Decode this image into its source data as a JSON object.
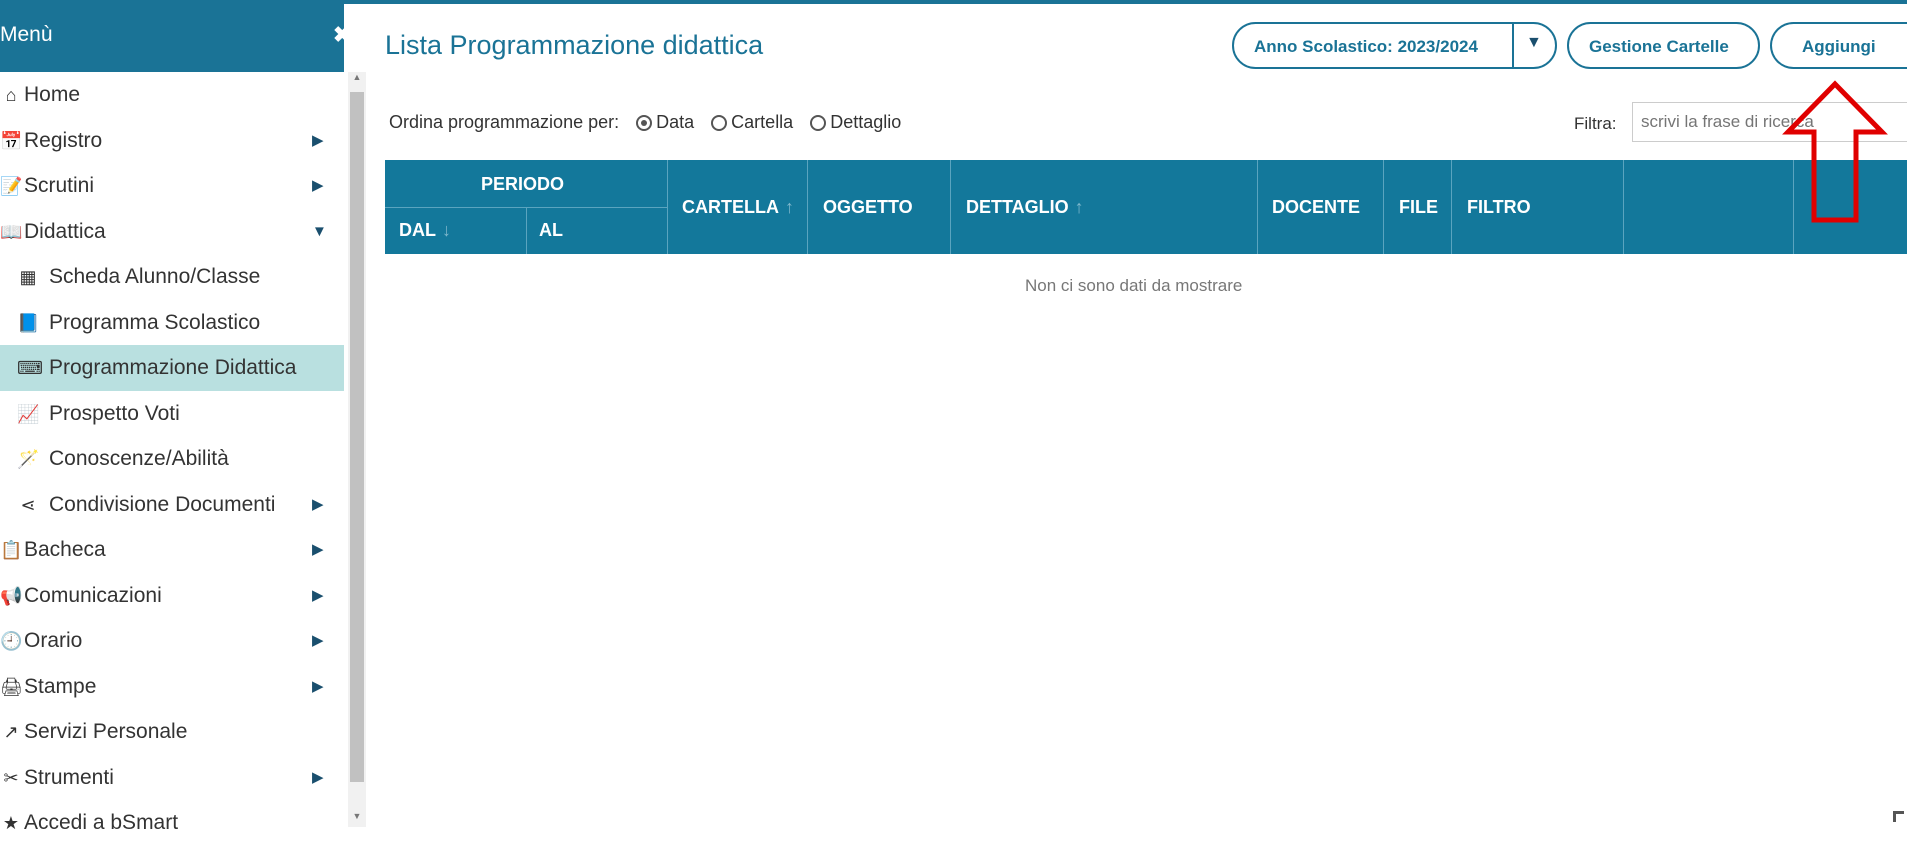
{
  "sidebar": {
    "title": "Menù",
    "close_icon": "✖",
    "items": [
      {
        "icon": "⌂",
        "label": "Home",
        "sub": false,
        "arrow": "",
        "active": false
      },
      {
        "icon": "📅",
        "label": "Registro",
        "sub": false,
        "arrow": "▶",
        "active": false
      },
      {
        "icon": "📝",
        "label": "Scrutini",
        "sub": false,
        "arrow": "▶",
        "active": false
      },
      {
        "icon": "📖",
        "label": "Didattica",
        "sub": false,
        "arrow": "▼",
        "active": false
      },
      {
        "icon": "▦",
        "label": "Scheda Alunno/Classe",
        "sub": true,
        "arrow": "",
        "active": false
      },
      {
        "icon": "📘",
        "label": "Programma Scolastico",
        "sub": true,
        "arrow": "",
        "active": false
      },
      {
        "icon": "⌨",
        "label": "Programmazione Didattica",
        "sub": true,
        "arrow": "",
        "active": true
      },
      {
        "icon": "📈",
        "label": "Prospetto Voti",
        "sub": true,
        "arrow": "",
        "active": false
      },
      {
        "icon": "🪄",
        "label": "Conoscenze/Abilità",
        "sub": true,
        "arrow": "",
        "active": false
      },
      {
        "icon": "⋖",
        "label": "Condivisione Documenti",
        "sub": true,
        "arrow": "▶",
        "active": false
      },
      {
        "icon": "📋",
        "label": "Bacheca",
        "sub": false,
        "arrow": "▶",
        "active": false
      },
      {
        "icon": "📢",
        "label": "Comunicazioni",
        "sub": false,
        "arrow": "▶",
        "active": false
      },
      {
        "icon": "🕘",
        "label": "Orario",
        "sub": false,
        "arrow": "▶",
        "active": false
      },
      {
        "icon": "🖨",
        "label": "Stampe",
        "sub": false,
        "arrow": "▶",
        "active": false
      },
      {
        "icon": "↗",
        "label": "Servizi Personale",
        "sub": false,
        "arrow": "",
        "active": false
      },
      {
        "icon": "✂",
        "label": "Strumenti",
        "sub": false,
        "arrow": "▶",
        "active": false
      },
      {
        "icon": "★",
        "label": "Accedi a bSmart",
        "sub": false,
        "arrow": "",
        "active": false
      }
    ]
  },
  "header": {
    "title": "Lista Programmazione didattica",
    "year_selector": "Anno Scolastico: 2023/2024",
    "gestione_button": "Gestione Cartelle",
    "add_button": "Aggiungi"
  },
  "order": {
    "label": "Ordina programmazione per:",
    "options": [
      "Data",
      "Cartella",
      "Dettaglio"
    ],
    "selected": "Data"
  },
  "filter": {
    "label": "Filtra:",
    "placeholder": "scrivi la frase di ricerca"
  },
  "table": {
    "group_header": "PERIODO",
    "columns": {
      "dal": "DAL",
      "al": "AL",
      "cartella": "CARTELLA",
      "oggetto": "OGGETTO",
      "dettaglio": "DETTAGLIO",
      "docente": "DOCENTE",
      "file": "FILE",
      "filtro": "FILTRO"
    },
    "empty_message": "Non ci sono dati da mostrare"
  },
  "colors": {
    "accent": "#1a7396",
    "table_header": "#13789b",
    "active_item": "#b9e0e0",
    "annotation": "#e00000"
  }
}
